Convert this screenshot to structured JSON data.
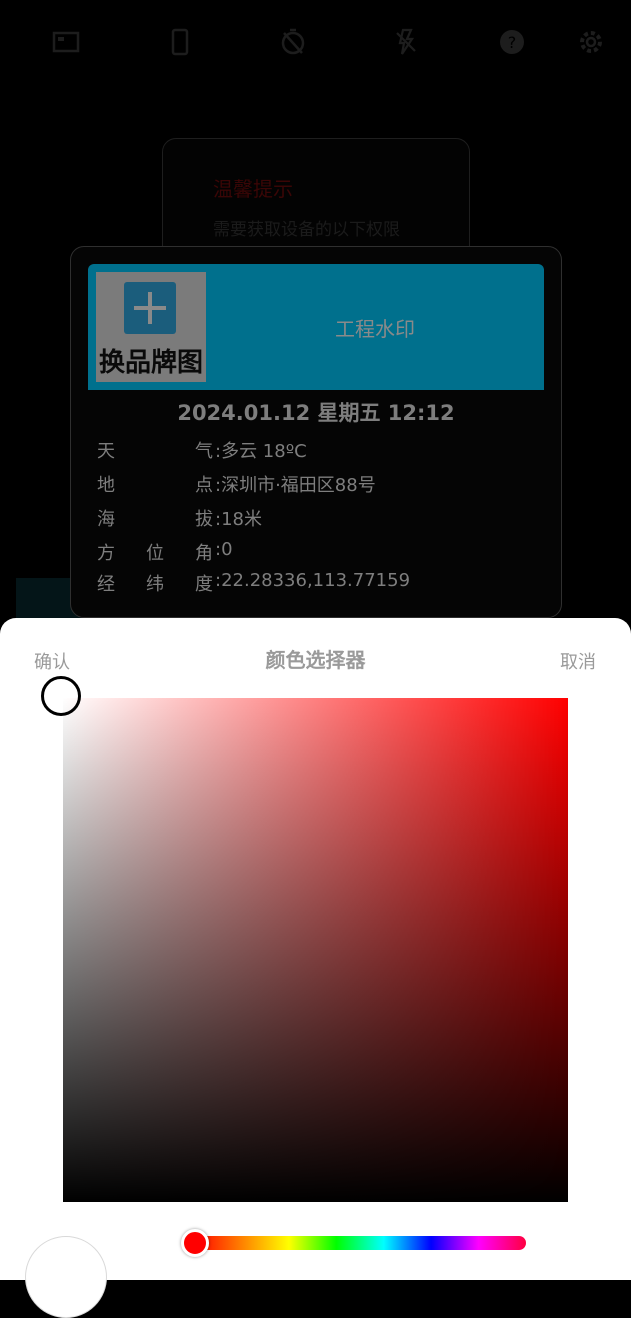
{
  "toolbar": {
    "icons": [
      "aspect-ratio-icon",
      "phone-icon",
      "timer-off-icon",
      "flash-off-icon",
      "help-icon",
      "settings-icon"
    ]
  },
  "permission_prompt": {
    "title": "温馨提示",
    "text": "需要获取设备的以下权限"
  },
  "watermark": {
    "brand_label": "换品牌图",
    "title": "工程水印",
    "datetime": "2024.01.12 星期五 12:12",
    "rows": [
      {
        "label": [
          "天",
          "气"
        ],
        "value": "多云 18ºC"
      },
      {
        "label": [
          "地",
          "点"
        ],
        "value": "深圳市·福田区88号"
      },
      {
        "label": [
          "海",
          "拔"
        ],
        "value": "18米"
      },
      {
        "label": [
          "方",
          "位",
          "角"
        ],
        "value": "0"
      },
      {
        "label": [
          "经",
          "纬",
          "度"
        ],
        "value": "22.28336,113.77159"
      }
    ],
    "colors": {
      "header_bg": "#00708d"
    }
  },
  "color_picker": {
    "confirm_label": "确认",
    "title": "颜色选择器",
    "cancel_label": "取消",
    "hue_color": "#ff0000",
    "selected_color": "#ffffff",
    "saturation": 0,
    "brightness": 1
  }
}
